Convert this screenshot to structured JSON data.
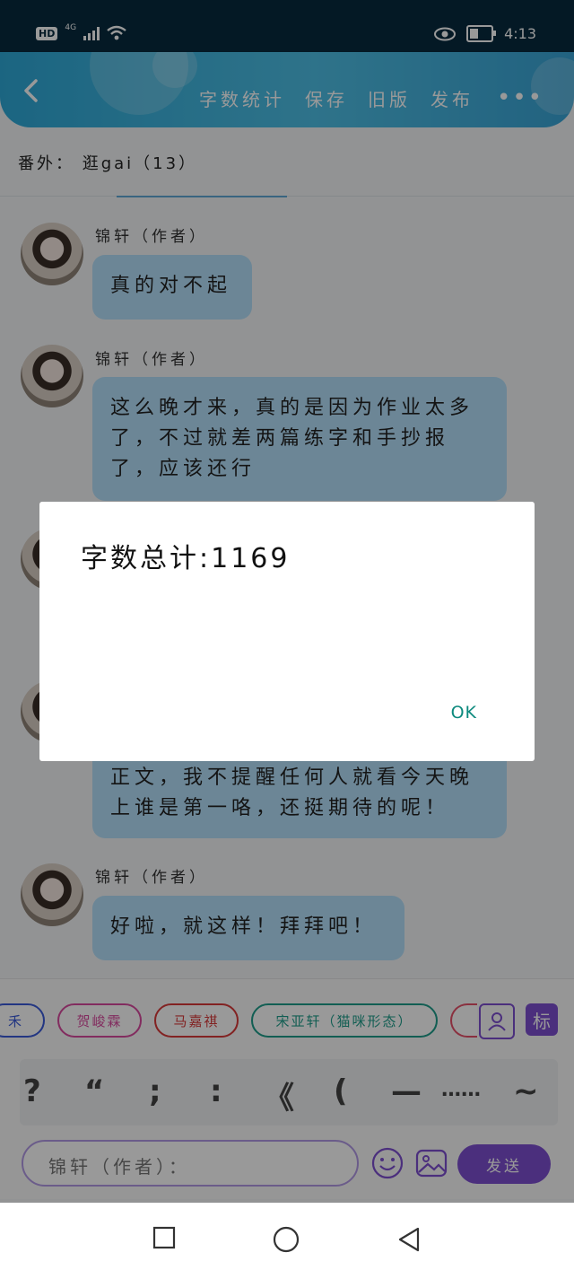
{
  "status_bar": {
    "hd": "HD",
    "signal": "4G",
    "time": "4:13"
  },
  "header": {
    "toolbar": [
      "字数统计",
      "保存",
      "旧版",
      "发布"
    ],
    "more": "•••"
  },
  "chapter_title": "番外：  逛gai（13）",
  "messages": [
    {
      "author": "锦轩（作者）",
      "text": "真的对不起"
    },
    {
      "author": "锦轩（作者）",
      "text": "这么晚才来，真的是因为作业太多了，不过就差两篇练字和手抄报了，应该还行"
    },
    {
      "author": "",
      "text": "正文，我不提醒任何人就看今天晚上谁是第一咯，还挺期待的呢！"
    },
    {
      "author": "锦轩（作者）",
      "text": "好啦，就这样！拜拜吧！"
    }
  ],
  "dialog": {
    "message": "字数总计:1169",
    "ok": "OK"
  },
  "role_tags": [
    {
      "label": "禾",
      "color": "#3b5bd9"
    },
    {
      "label": "贺峻霖",
      "color": "#d94a9e"
    },
    {
      "label": "马嘉祺",
      "color": "#d93a3a"
    },
    {
      "label": "宋亚轩（猫咪形态）",
      "color": "#1f9d8b"
    },
    {
      "label": "",
      "color": "#e6506a"
    }
  ],
  "tag_buttons": {
    "mark": "标"
  },
  "punctuation": [
    "?",
    "“",
    ";",
    ":",
    "《",
    "(",
    "—",
    "……",
    "~"
  ],
  "input": {
    "prefix": "锦轩（作者）："
  },
  "send": "发送",
  "colors": {
    "header": "#3fb3df",
    "bubble": "#b4e0fb",
    "accent": "#7e4fd1",
    "ok": "#0d8a7e"
  }
}
